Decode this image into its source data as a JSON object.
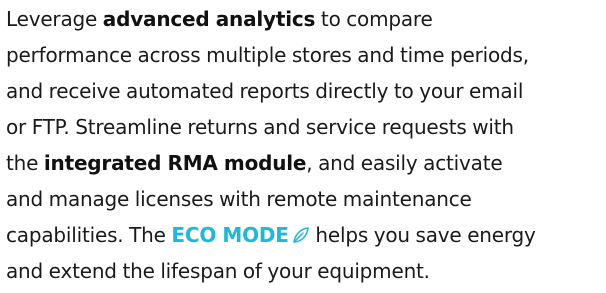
{
  "paragraph": {
    "line1_a": "Leverage ",
    "line1_bold": "advanced analytics",
    "line1_b": " to compare",
    "line2": "performance across multiple stores and time periods,",
    "line3": "and receive automated reports directly to your email",
    "line4": "or FTP. Streamline returns and service requests with",
    "line5_a": "the ",
    "line5_bold": "integrated RMA module",
    "line5_b": ", and easily activate",
    "line6": "and manage licenses with remote maintenance",
    "line7_a": "capabilities. The ",
    "line7_eco": "ECO MODE",
    "line7_b": " helps you save energy",
    "line8": "and extend the lifespan of your equipment."
  },
  "colors": {
    "text": "#1a1a1a",
    "eco_accent": "#1fb8d8"
  },
  "icons": {
    "eco_icon": "leaf-icon"
  }
}
